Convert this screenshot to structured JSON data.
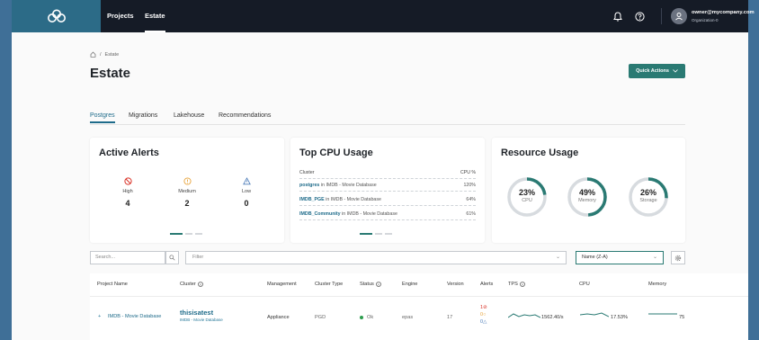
{
  "nav": {
    "projects": "Projects",
    "estate": "Estate",
    "user_email": "owner@mycompany.com",
    "user_org": "Organization-0"
  },
  "breadcrumb": {
    "separator": "/",
    "current": "Estate"
  },
  "page": {
    "title": "Estate",
    "quick_actions": "Quick Actions"
  },
  "tabs": [
    "Postgres",
    "Migrations",
    "Lakehouse",
    "Recommendations"
  ],
  "active_alerts": {
    "title": "Active Alerts",
    "items": [
      {
        "label": "High",
        "count": "4",
        "color": "#d93025",
        "icon": "blocked-icon"
      },
      {
        "label": "Medium",
        "count": "2",
        "color": "#e8a33a",
        "icon": "warning-circle-icon"
      },
      {
        "label": "Low",
        "count": "0",
        "color": "#4a7ab8",
        "icon": "warning-triangle-icon"
      }
    ]
  },
  "top_cpu": {
    "title": "Top CPU Usage",
    "col_cluster": "Cluster",
    "col_cpu": "CPU %",
    "rows": [
      {
        "name": "postgres",
        "rest": " in IMDB - Movie Database",
        "pct": "120%"
      },
      {
        "name": "IMDB_PGE",
        "rest": " in IMDB - Movie Database",
        "pct": "64%"
      },
      {
        "name": "IMDB_Community",
        "rest": " in IMDB - Movie Database",
        "pct": "61%"
      }
    ]
  },
  "resource_usage": {
    "title": "Resource Usage",
    "gauges": [
      {
        "pct_label": "23%",
        "value": 23,
        "label": "CPU"
      },
      {
        "pct_label": "49%",
        "value": 49,
        "label": "Memory"
      },
      {
        "pct_label": "26%",
        "value": 26,
        "label": "Storage"
      }
    ],
    "accent": "#2a7a73"
  },
  "filters": {
    "search_placeholder": "Search...",
    "filter_placeholder": "Filter",
    "sort_value": "Name (Z-A)"
  },
  "table": {
    "headers": {
      "project": "Project Name",
      "cluster": "Cluster",
      "management": "Management",
      "cluster_type": "Cluster Type",
      "status": "Status",
      "engine": "Engine",
      "version": "Version",
      "alerts": "Alerts",
      "tps": "TPS",
      "cpu": "CPU",
      "memory": "Memory"
    },
    "row": {
      "project": "IMDB - Movie Database",
      "cluster": "thisisatest",
      "cluster_project": "IMDB - Movie Database",
      "management": "Appliance",
      "cluster_type": "PGD",
      "status": "Ok",
      "engine": "epas",
      "version": "17",
      "alerts_high": "1",
      "alerts_medium": "0",
      "alerts_low": "0",
      "tps": "1562.40/s",
      "cpu": "17.53%",
      "memory": "75"
    }
  }
}
